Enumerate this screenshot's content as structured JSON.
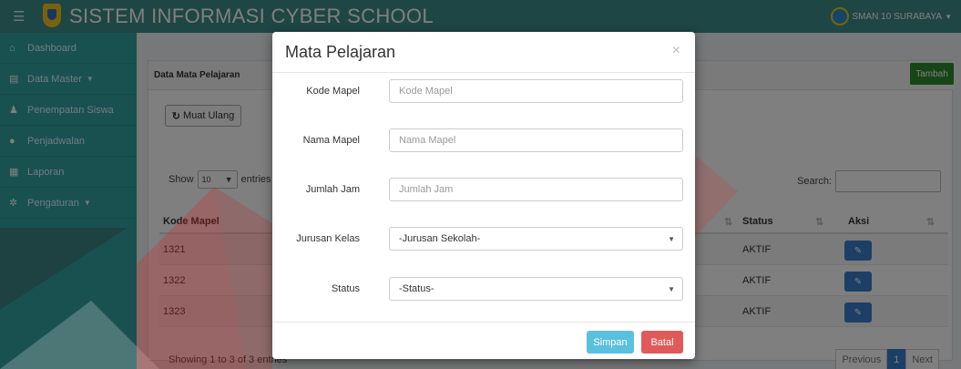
{
  "topbar": {
    "title": "SISTEM INFORMASI CYBER SCHOOL",
    "user": "SMAN 10 SURABAYA",
    "menu_icon": "hamburger-icon",
    "logo_icon": "school-crest-icon"
  },
  "sidebar": {
    "items": [
      {
        "label": "Dashboard",
        "icon": "home-icon"
      },
      {
        "label": "Data Master",
        "icon": "list-icon",
        "has_caret": true
      },
      {
        "label": "Penempatan Siswa",
        "icon": "users-icon"
      },
      {
        "label": "Penjadwalan",
        "icon": "clock-icon"
      },
      {
        "label": "Laporan",
        "icon": "report-icon"
      },
      {
        "label": "Pengaturan",
        "icon": "gear-icon",
        "has_caret": true
      }
    ]
  },
  "main": {
    "panel_title": "Data Mata Pelajaran",
    "add_label": "Tambah",
    "reload_label": "Muat Ulang",
    "show_prefix": "Show",
    "show_value": "10",
    "show_suffix": "entries",
    "search_label": "Search:",
    "columns": {
      "kode": "Kode Mapel",
      "status": "Status",
      "aksi": "Aksi"
    },
    "rows": [
      {
        "kode": "1321",
        "status": "AKTIF"
      },
      {
        "kode": "1322",
        "status": "AKTIF"
      },
      {
        "kode": "1323",
        "status": "AKTIF"
      }
    ],
    "info": "Showing 1 to 3 of 3 entries",
    "pager": {
      "previous": "Previous",
      "current": "1",
      "next": "Next"
    }
  },
  "modal": {
    "title": "Mata Pelajaran",
    "close": "×",
    "fields": {
      "kode": {
        "label": "Kode Mapel",
        "placeholder": "Kode Mapel"
      },
      "nama": {
        "label": "Nama Mapel",
        "placeholder": "Nama Mapel"
      },
      "jam": {
        "label": "Jumlah Jam",
        "placeholder": "Jumlah Jam"
      },
      "jurusan": {
        "label": "Jurusan Kelas",
        "value": "-Jurusan Sekolah-"
      },
      "status": {
        "label": "Status",
        "value": "-Status-"
      }
    },
    "save_label": "Simpan",
    "cancel_label": "Batal"
  },
  "colors": {
    "topbar": "#3c8d8a",
    "sidebar": "#33a3a3",
    "add_button": "#2e8b2e",
    "save_button": "#5bc0de",
    "cancel_button": "#e05a5a",
    "primary": "#3a7fcb"
  }
}
